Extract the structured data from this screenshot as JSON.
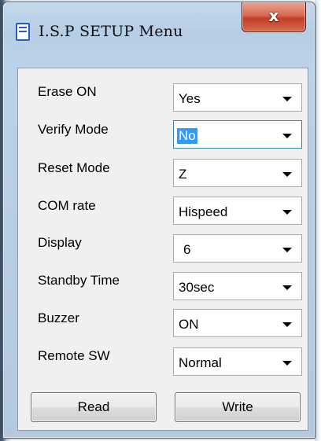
{
  "window": {
    "title": "I.S.P SETUP Menu",
    "icon": "app-window-icon",
    "close_icon": "close-x-icon",
    "close_glyph": "x"
  },
  "settings": [
    {
      "label": "Erase ON",
      "value": "Yes"
    },
    {
      "label": "Verify Mode",
      "value": "No"
    },
    {
      "label": "Reset Mode",
      "value": "Z"
    },
    {
      "label": "COM rate",
      "value": "Hispeed"
    },
    {
      "label": "Display",
      "value": "6"
    },
    {
      "label": "Standby Time",
      "value": "30sec"
    },
    {
      "label": "Buzzer",
      "value": "ON"
    },
    {
      "label": "Remote SW",
      "value": "Normal"
    }
  ],
  "focused_setting": "Verify Mode",
  "buttons": {
    "read_label": "Read",
    "write_label": "Write"
  },
  "colors": {
    "close_button": "#c94a33",
    "selection_highlight": "#3399ff",
    "client_background": "#f0f0f0",
    "frame": "#b6cde4"
  }
}
